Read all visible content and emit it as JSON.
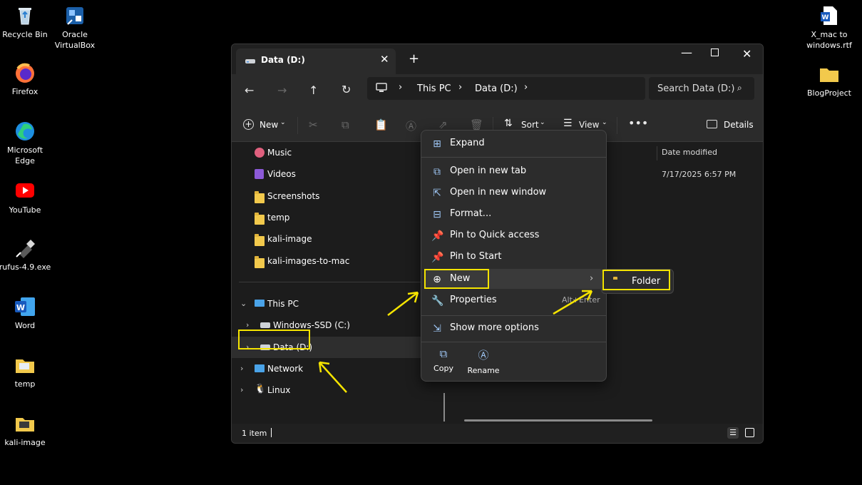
{
  "desktop": {
    "icons_left": [
      {
        "label": "Recycle Bin",
        "icon": "recycle-bin-icon"
      },
      {
        "label": "Oracle VirtualBox",
        "icon": "virtualbox-icon"
      },
      {
        "label": "Firefox",
        "icon": "firefox-icon"
      },
      {
        "label": "Microsoft Edge",
        "icon": "edge-icon"
      },
      {
        "label": "YouTube",
        "icon": "youtube-icon"
      },
      {
        "label": "rufus-4.9.exe",
        "icon": "usb-icon"
      },
      {
        "label": "Word",
        "icon": "word-icon"
      },
      {
        "label": "temp",
        "icon": "folder-icon"
      },
      {
        "label": "kali-image",
        "icon": "folder-icon"
      }
    ],
    "icons_right": [
      {
        "label": "X_mac to windows.rtf",
        "icon": "word-document-icon"
      },
      {
        "label": "BlogProject",
        "icon": "folder-icon"
      }
    ]
  },
  "window": {
    "tab_title": "Data (D:)",
    "breadcrumb": [
      "This PC",
      "Data (D:)"
    ],
    "search_placeholder": "Search Data (D:)",
    "commands": {
      "new": "New",
      "sort": "Sort",
      "view": "View",
      "details": "Details"
    },
    "sidebar": {
      "quick_items": [
        "Music",
        "Videos",
        "Screenshots",
        "temp",
        "kali-image",
        "kali-images-to-mac"
      ],
      "this_pc": "This PC",
      "drives": [
        "Windows-SSD (C:)",
        "Data (D:)"
      ],
      "network": "Network",
      "linux": "Linux"
    },
    "content": {
      "column_date": "Date modified",
      "row_date": "7/17/2025 6:57 PM"
    },
    "status": "1 item"
  },
  "context_menu": {
    "items": [
      {
        "label": "Expand",
        "icon": "expand-icon"
      },
      {
        "label": "Open in new tab",
        "icon": "new-tab-icon"
      },
      {
        "label": "Open in new window",
        "icon": "new-window-icon"
      },
      {
        "label": "Format...",
        "icon": "format-icon"
      },
      {
        "label": "Pin to Quick access",
        "icon": "pin-icon"
      },
      {
        "label": "Pin to Start",
        "icon": "pin-icon"
      },
      {
        "label": "New",
        "icon": "plus-circle-icon"
      },
      {
        "label": "Properties",
        "icon": "wrench-icon",
        "shortcut": "Alt+Enter"
      },
      {
        "label": "Show more options",
        "icon": "more-options-icon"
      }
    ],
    "bottom": {
      "copy": "Copy",
      "rename": "Rename"
    },
    "submenu": {
      "folder": "Folder"
    }
  },
  "colors": {
    "highlight": "#f5e400",
    "accent": "#9ec6f5"
  }
}
